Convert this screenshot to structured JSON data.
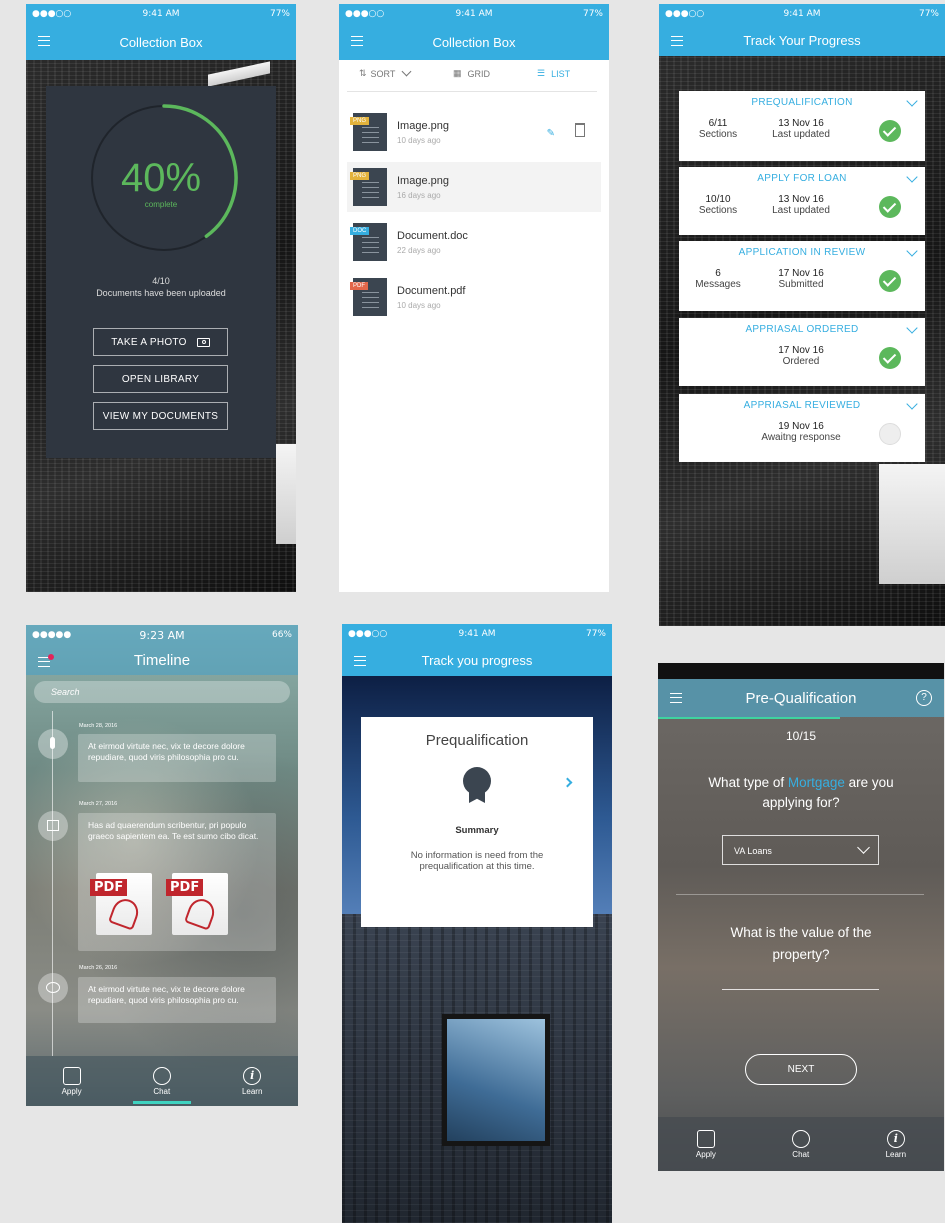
{
  "status_default": {
    "carrier": "●●●○○",
    "time": "9:41 AM",
    "battery": "77%"
  },
  "status_timeline": {
    "carrier": "●●●●●",
    "time": "9:23 AM",
    "battery": "66%"
  },
  "screen1": {
    "title": "Collection Box",
    "percent": "40%",
    "percent_sub": "complete",
    "progress": 0.4,
    "count": "4/10",
    "count_label": "Documents have been uploaded",
    "btn_photo": "TAKE A PHOTO",
    "btn_library": "OPEN LIBRARY",
    "btn_docs": "VIEW MY DOCUMENTS"
  },
  "screen2": {
    "title": "Collection Box",
    "sort": "SORT",
    "grid": "GRID",
    "list": "LIST",
    "files": [
      {
        "name": "Image.png",
        "date": "10 days ago",
        "type": "PNG"
      },
      {
        "name": "Image.png",
        "date": "16 days ago",
        "type": "PNG"
      },
      {
        "name": "Document.doc",
        "date": "22 days ago",
        "type": "DOC"
      },
      {
        "name": "Document.pdf",
        "date": "10 days ago",
        "type": "PDF"
      }
    ]
  },
  "screen3": {
    "title": "Track Your Progress",
    "cards": [
      {
        "title": "PREQUALIFICATION",
        "a": "6/11",
        "a_sub": "Sections",
        "b": "13 Nov 16",
        "b_sub": "Last updated",
        "done": true
      },
      {
        "title": "APPLY FOR LOAN",
        "a": "10/10",
        "a_sub": "Sections",
        "b": "13 Nov 16",
        "b_sub": "Last updated",
        "done": true
      },
      {
        "title": "APPLICATION IN REVIEW",
        "a": "6",
        "a_sub": "Messages",
        "b": "17 Nov 16",
        "b_sub": "Submitted",
        "done": true
      },
      {
        "title": "APPRIASAL ORDERED",
        "a": "",
        "a_sub": "",
        "b": "17 Nov 16",
        "b_sub": "Ordered",
        "done": true
      },
      {
        "title": "APPRIASAL REVIEWED",
        "a": "",
        "a_sub": "",
        "b": "19 Nov 16",
        "b_sub": "Awaitng response",
        "done": false
      }
    ]
  },
  "screen4": {
    "title": "Timeline",
    "search_placeholder": "Search",
    "entries": [
      {
        "date": "March 28, 2016",
        "text": "At eirmod virtute nec, vix te decore dolore repudiare, quod viris philosophia pro cu."
      },
      {
        "date": "March 27, 2016",
        "text": "Has ad quaerendum scribentur, pri populo graeco sapientem ea. Te est sumo cibo dicat."
      },
      {
        "date": "March 26, 2016",
        "text": "At eirmod virtute nec, vix te decore dolore repudiare, quod viris philosophia pro cu."
      }
    ],
    "pdf_label": "PDF",
    "tabs": {
      "apply": "Apply",
      "chat": "Chat",
      "learn": "Learn"
    }
  },
  "screen5": {
    "title": "Track you progress",
    "card_title": "Prequalification",
    "summary": "Summary",
    "body": "No information is need from the prequalification at this time."
  },
  "screen6": {
    "title": "Pre-Qualification",
    "help": "?",
    "counter": "10/15",
    "q1_pre": "What type of ",
    "q1_highlight": "Mortgage",
    "q1_post": " are you applying for?",
    "select_value": "VA Loans",
    "q2": "What is the value of the property?",
    "next": "NEXT",
    "tabs": {
      "apply": "Apply",
      "chat": "Chat",
      "learn": "Learn"
    }
  },
  "colors": {
    "accent": "#36aee0",
    "green": "#5cb85c"
  }
}
